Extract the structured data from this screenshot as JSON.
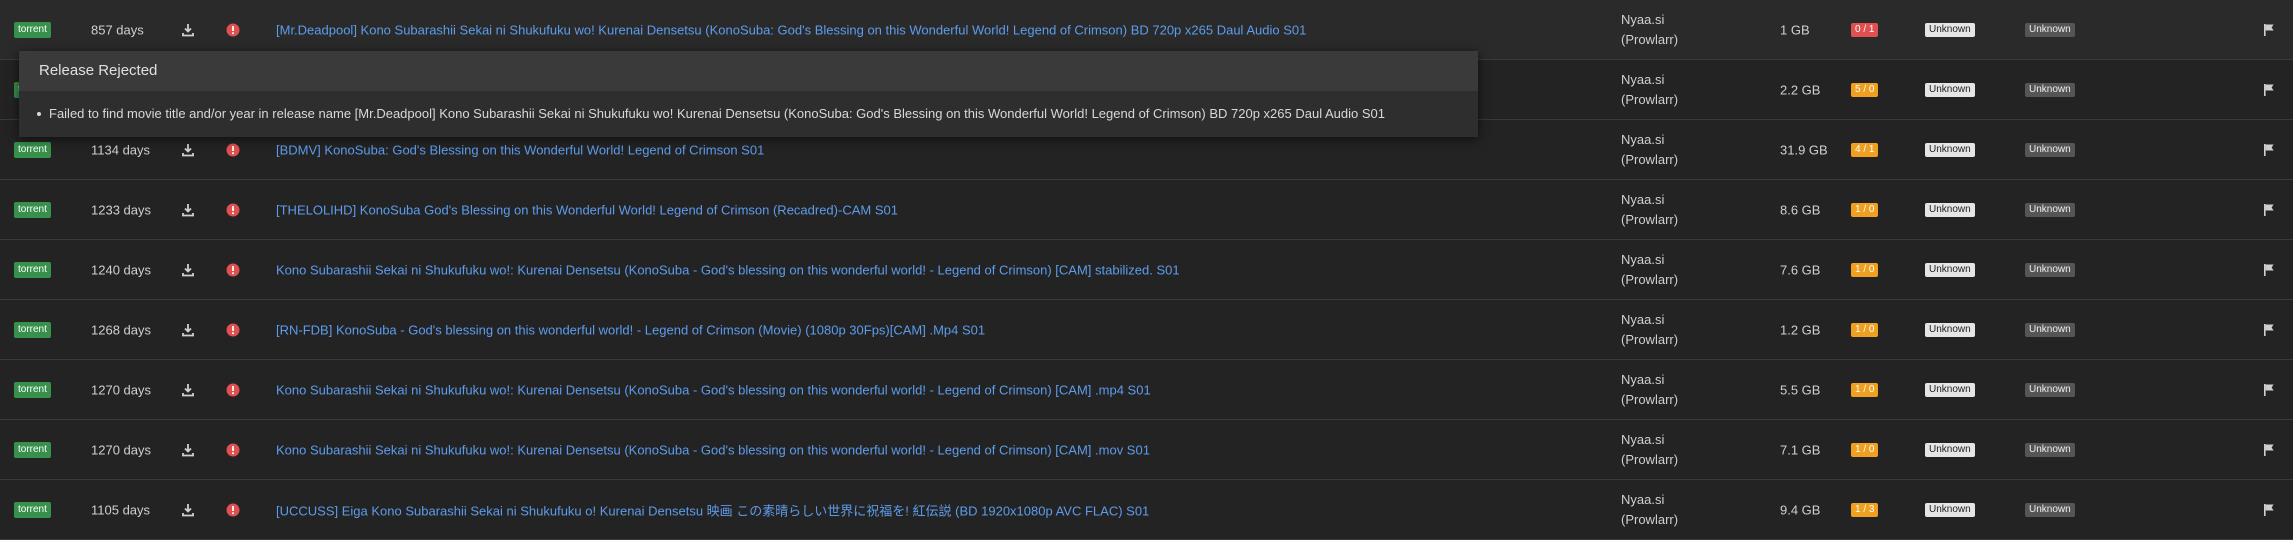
{
  "popover": {
    "title": "Release Rejected",
    "reasons": [
      "Failed to find movie title and/or year in release name [Mr.Deadpool] Kono Subarashii Sekai ni Shukufuku wo! Kurenai Densetsu (KonoSuba: God's Blessing on this Wonderful World! Legend of Crimson) BD 720p x265 Daul Audio S01"
    ]
  },
  "colors": {
    "peer_red": "#e05050",
    "peer_orange": "#f0a020",
    "link": "#5d9cec",
    "protocol_green": "#37904b"
  },
  "rows": [
    {
      "protocol": "torrent",
      "age": "857 days",
      "title": "[Mr.Deadpool] Kono Subarashii Sekai ni Shukufuku wo! Kurenai Densetsu (KonoSuba: God's Blessing on this Wonderful World! Legend of Crimson) BD 720p x265 Daul Audio S01",
      "indexer_1": "Nyaa.si",
      "indexer_2": "(Prowlarr)",
      "size": "1 GB",
      "peers": "0 / 1",
      "peer_color": "#e05050",
      "language": "Unknown",
      "quality": "Unknown"
    },
    {
      "protocol": "torrent",
      "age": "",
      "title": "",
      "indexer_1": "Nyaa.si",
      "indexer_2": "(Prowlarr)",
      "size": "2.2 GB",
      "peers": "5 / 0",
      "peer_color": "#f0a020",
      "language": "Unknown",
      "quality": "Unknown"
    },
    {
      "protocol": "torrent",
      "age": "1134 days",
      "title": "[BDMV] KonoSuba: God's Blessing on this Wonderful World! Legend of Crimson S01",
      "indexer_1": "Nyaa.si",
      "indexer_2": "(Prowlarr)",
      "size": "31.9 GB",
      "peers": "4 / 1",
      "peer_color": "#f0a020",
      "language": "Unknown",
      "quality": "Unknown"
    },
    {
      "protocol": "torrent",
      "age": "1233 days",
      "title": "[THELOLIHD] KonoSuba God's Blessing on this Wonderful World! Legend of Crimson (Recadred)-CAM S01",
      "indexer_1": "Nyaa.si",
      "indexer_2": "(Prowlarr)",
      "size": "8.6 GB",
      "peers": "1 / 0",
      "peer_color": "#f0a020",
      "language": "Unknown",
      "quality": "Unknown"
    },
    {
      "protocol": "torrent",
      "age": "1240 days",
      "title": "Kono Subarashii Sekai ni Shukufuku wo!: Kurenai Densetsu (KonoSuba - God's blessing on this wonderful world! - Legend of Crimson) [CAM] stabilized. S01",
      "indexer_1": "Nyaa.si",
      "indexer_2": "(Prowlarr)",
      "size": "7.6 GB",
      "peers": "1 / 0",
      "peer_color": "#f0a020",
      "language": "Unknown",
      "quality": "Unknown"
    },
    {
      "protocol": "torrent",
      "age": "1268 days",
      "title": "[RN-FDB] KonoSuba - God's blessing on this wonderful world! - Legend of Crimson (Movie) (1080p 30Fps)[CAM] .Mp4 S01",
      "indexer_1": "Nyaa.si",
      "indexer_2": "(Prowlarr)",
      "size": "1.2 GB",
      "peers": "1 / 0",
      "peer_color": "#f0a020",
      "language": "Unknown",
      "quality": "Unknown"
    },
    {
      "protocol": "torrent",
      "age": "1270 days",
      "title": "Kono Subarashii Sekai ni Shukufuku wo!: Kurenai Densetsu (KonoSuba - God's blessing on this wonderful world! - Legend of Crimson) [CAM] .mp4 S01",
      "indexer_1": "Nyaa.si",
      "indexer_2": "(Prowlarr)",
      "size": "5.5 GB",
      "peers": "1 / 0",
      "peer_color": "#f0a020",
      "language": "Unknown",
      "quality": "Unknown"
    },
    {
      "protocol": "torrent",
      "age": "1270 days",
      "title": "Kono Subarashii Sekai ni Shukufuku wo!: Kurenai Densetsu (KonoSuba - God's blessing on this wonderful world! - Legend of Crimson) [CAM] .mov S01",
      "indexer_1": "Nyaa.si",
      "indexer_2": "(Prowlarr)",
      "size": "7.1 GB",
      "peers": "1 / 0",
      "peer_color": "#f0a020",
      "language": "Unknown",
      "quality": "Unknown"
    },
    {
      "protocol": "torrent",
      "age": "1105 days",
      "title": "[UCCUSS] Eiga Kono Subarashii Sekai ni Shukufuku o! Kurenai Densetsu 映画 この素晴らしい世界に祝福を! 紅伝説 (BD 1920x1080p AVC FLAC) S01",
      "indexer_1": "Nyaa.si",
      "indexer_2": "(Prowlarr)",
      "size": "9.4 GB",
      "peers": "1 / 3",
      "peer_color": "#f0a020",
      "language": "Unknown",
      "quality": "Unknown"
    }
  ]
}
